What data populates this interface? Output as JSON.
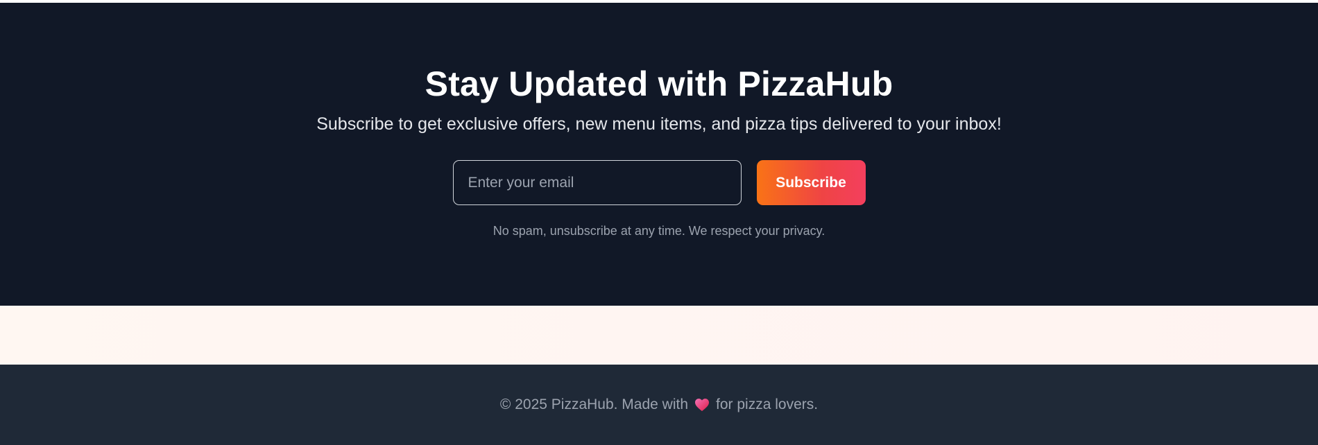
{
  "newsletter": {
    "title": "Stay Updated with PizzaHub",
    "subtitle": "Subscribe to get exclusive offers, new menu items, and pizza tips delivered to your inbox!",
    "email_placeholder": "Enter your email",
    "email_value": "",
    "subscribe_label": "Subscribe",
    "note": "No spam, unsubscribe at any time. We respect your privacy."
  },
  "footer": {
    "text_before": "© 2025 PizzaHub. Made with",
    "icon": "heart-icon",
    "text_after": "for pizza lovers."
  },
  "colors": {
    "newsletter_bg": "#111827",
    "footer_bg": "#1f2937",
    "button_gradient_start": "#f97316",
    "button_gradient_end": "#f43f5e",
    "heart": "#ec4899"
  }
}
